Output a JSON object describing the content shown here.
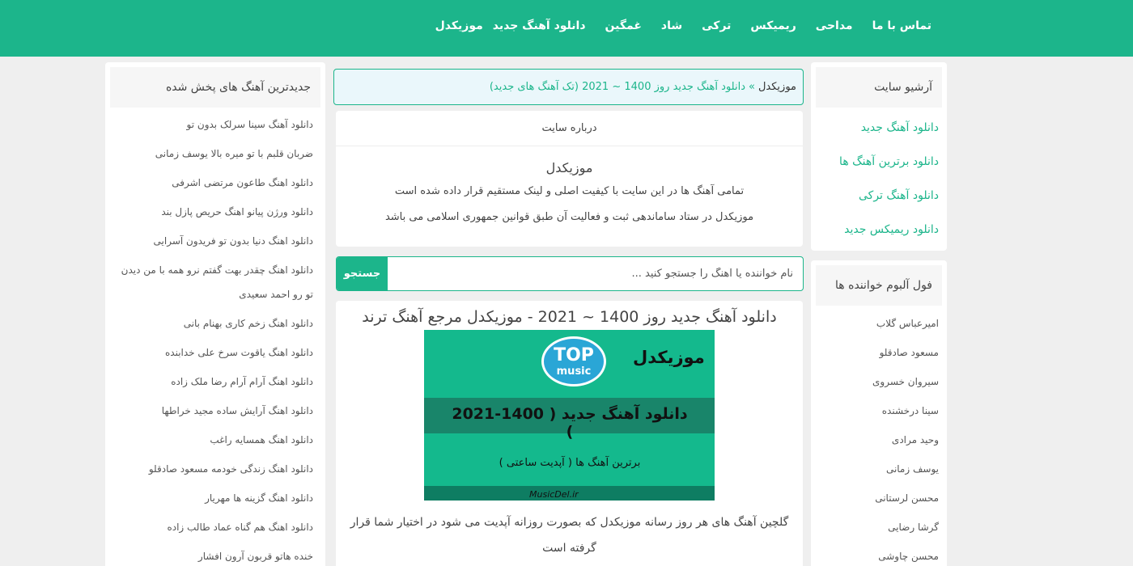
{
  "nav": {
    "items": [
      "موزیکدل",
      "دانلود آهنگ جدید",
      "غمگین",
      "شاد",
      "ترکی",
      "ریمیکس",
      "مداحی",
      "تماس با ما"
    ]
  },
  "archive": {
    "title": "آرشیو سایت",
    "links": [
      "دانلود آهنگ جدید",
      "دانلود برترین آهنگ ها",
      "دانلود آهنگ ترکی",
      "دانلود ریمیکس جدید"
    ]
  },
  "albums": {
    "title": "فول آلبوم خواننده ها",
    "items": [
      "امیرعباس گلاب",
      "مسعود صادقلو",
      "سیروان خسروی",
      "سینا درخشنده",
      "وحید مرادی",
      "یوسف زمانی",
      "محسن لرستانی",
      "گرشا رضایی",
      "محسن چاوشی"
    ]
  },
  "latest": {
    "title": "جدیدترین آهنگ های پخش شده",
    "items": [
      "دانلود آهنگ سینا سرلک بدون تو",
      "ضربان قلبم با تو میره بالا یوسف زمانی",
      "دانلود اهنگ طاعون مرتضی اشرفی",
      "دانلود ورژن پیانو اهنگ حریص پازل بند",
      "دانلود اهنگ دنیا بدون تو فریدون آسرایی",
      "دانلود اهنگ چقدر بهت گفتم نرو همه با من دیدن تو رو احمد سعیدی",
      "دانلود اهنگ زخم کاری بهنام بانی",
      "دانلود اهنگ یاقوت سرخ علی خدابنده",
      "دانلود اهنگ آرام آرام رضا ملک زاده",
      "دانلود اهنگ آرایش ساده مجید خراطها",
      "دانلود اهنگ همسایه راغب",
      "دانلود اهنگ زندگی خودمه مسعود صادقلو",
      "دانلود اهنگ گزینه ها مهریار",
      "دانلود اهنگ هم گناه عماد طالب زاده",
      "خنده هاتو قربون آرون افشار"
    ]
  },
  "breadcrumb": {
    "home": "موزیکدل",
    "separator": "»",
    "current": "دانلود آهنگ جدید روز 1400 ~ 2021 (تک آهنگ های جدید)"
  },
  "about": {
    "heading": "درباره سایت",
    "name": "موزیکدل",
    "line1": "تمامی آهنگ ها در این سایت با کیفیت اصلی و لینک مستقیم قرار داده شده است",
    "line2": "موزیکدل در ستاد ساماندهی ثبت و فعالیت آن طبق قوانین جمهوری اسلامی می باشد"
  },
  "search": {
    "placeholder": "نام خواننده یا آهنگ را جستجو کنید ...",
    "button": "جستجو"
  },
  "post": {
    "title": "دانلود آهنگ جدید روز 1400 ~ 2021 - موزیکدل مرجع آهنگ ترند",
    "banner": {
      "logo_top": "TOP",
      "logo_bottom": "music",
      "brand": "موزیکدل",
      "main_text": "دانلود آهنگ جدید ( 1400-2021 )",
      "sub_text": "برترین آهنگ ها ( آپدیت ساعتی )",
      "url": "MusicDel.ir"
    },
    "description": "گلچین آهنگ های هر روز رسانه موزیکدل که بصورت روزانه آپدیت می شود در اختیار شما قرار گرفته است"
  },
  "colors": {
    "brand": "#1cb58b",
    "background": "#efefef",
    "breadcrumb_bg": "#eaf7fb"
  }
}
